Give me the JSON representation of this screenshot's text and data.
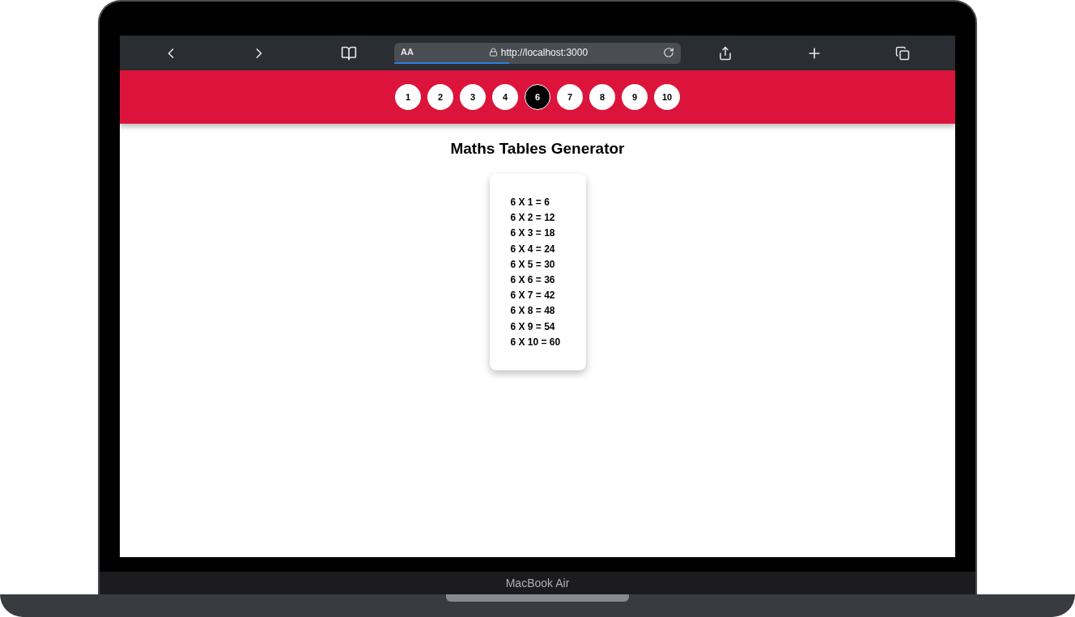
{
  "browser": {
    "text_size": "AA",
    "url": "http://localhost:3000",
    "load_progress": {
      "level": 0.4
    }
  },
  "number_buttons": [
    {
      "label": "1",
      "selected": false
    },
    {
      "label": "2",
      "selected": false
    },
    {
      "label": "3",
      "selected": false
    },
    {
      "label": "4",
      "selected": false
    },
    {
      "label": "6",
      "selected": true
    },
    {
      "label": "7",
      "selected": false
    },
    {
      "label": "8",
      "selected": false
    },
    {
      "label": "9",
      "selected": false
    },
    {
      "label": "10",
      "selected": false
    }
  ],
  "title": "Maths Tables Generator",
  "table_lines": [
    "6 X 1 = 6",
    "6 X 2 = 12",
    "6 X 3 = 18",
    "6 X 4 = 24",
    "6 X 5 = 30",
    "6 X 6 = 36",
    "6 X 7 = 42",
    "6 X 8 = 48",
    "6 X 9 = 54",
    "6 X 10 = 60"
  ],
  "device_label": "MacBook Air"
}
